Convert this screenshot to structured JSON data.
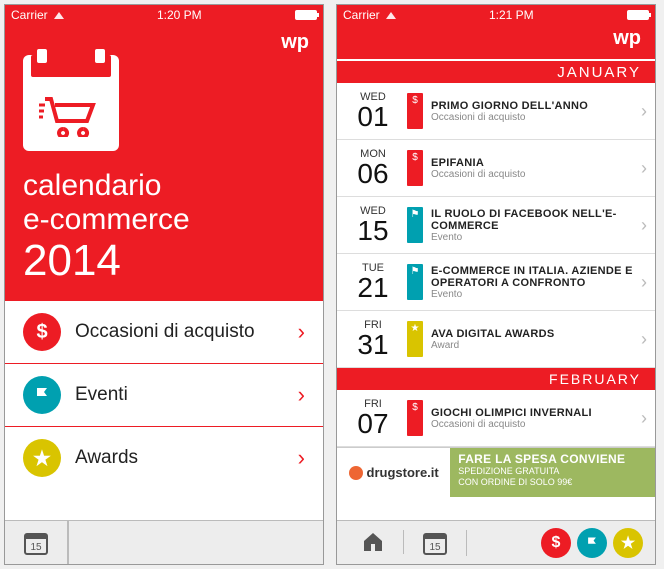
{
  "status": {
    "carrier": "Carrier",
    "time_left": "1:20 PM",
    "time_right": "1:21 PM"
  },
  "brand": "wp",
  "hero": {
    "line1": "calendario",
    "line2": "e-commerce",
    "line3": "2014"
  },
  "categories": [
    {
      "label": "Occasioni di acquisto",
      "color": "red",
      "icon": "dollar"
    },
    {
      "label": "Eventi",
      "color": "teal",
      "icon": "flag"
    },
    {
      "label": "Awards",
      "color": "yellow",
      "icon": "star"
    }
  ],
  "tabbar": {
    "cal_day": "15"
  },
  "months": {
    "jan": "JANUARY",
    "feb": "FEBRUARY"
  },
  "events": [
    {
      "dow": "WED",
      "day": "01",
      "flag": "red",
      "title": "PRIMO GIORNO DELL'ANNO",
      "sub": "Occasioni di acquisto"
    },
    {
      "dow": "MON",
      "day": "06",
      "flag": "red",
      "title": "EPIFANIA",
      "sub": "Occasioni di acquisto"
    },
    {
      "dow": "WED",
      "day": "15",
      "flag": "teal",
      "title": "IL RUOLO DI FACEBOOK NELL'E-COMMERCE",
      "sub": "Evento"
    },
    {
      "dow": "TUE",
      "day": "21",
      "flag": "teal",
      "title": "E-COMMERCE IN ITALIA. AZIENDE E OPERATORI A CONFRONTO",
      "sub": "Evento"
    },
    {
      "dow": "FRI",
      "day": "31",
      "flag": "yellow",
      "title": "AVA DIGITAL AWARDS",
      "sub": "Award"
    }
  ],
  "events_feb": [
    {
      "dow": "FRI",
      "day": "07",
      "flag": "red",
      "title": "GIOCHI OLIMPICI INVERNALI",
      "sub": "Occasioni di acquisto"
    }
  ],
  "ad": {
    "logo": "drugstore.it",
    "headline": "FARE LA SPESA CONVIENE",
    "sub1": "SPEDIZIONE GRATUITA",
    "sub2": "CON ORDINE DI SOLO 99€"
  }
}
